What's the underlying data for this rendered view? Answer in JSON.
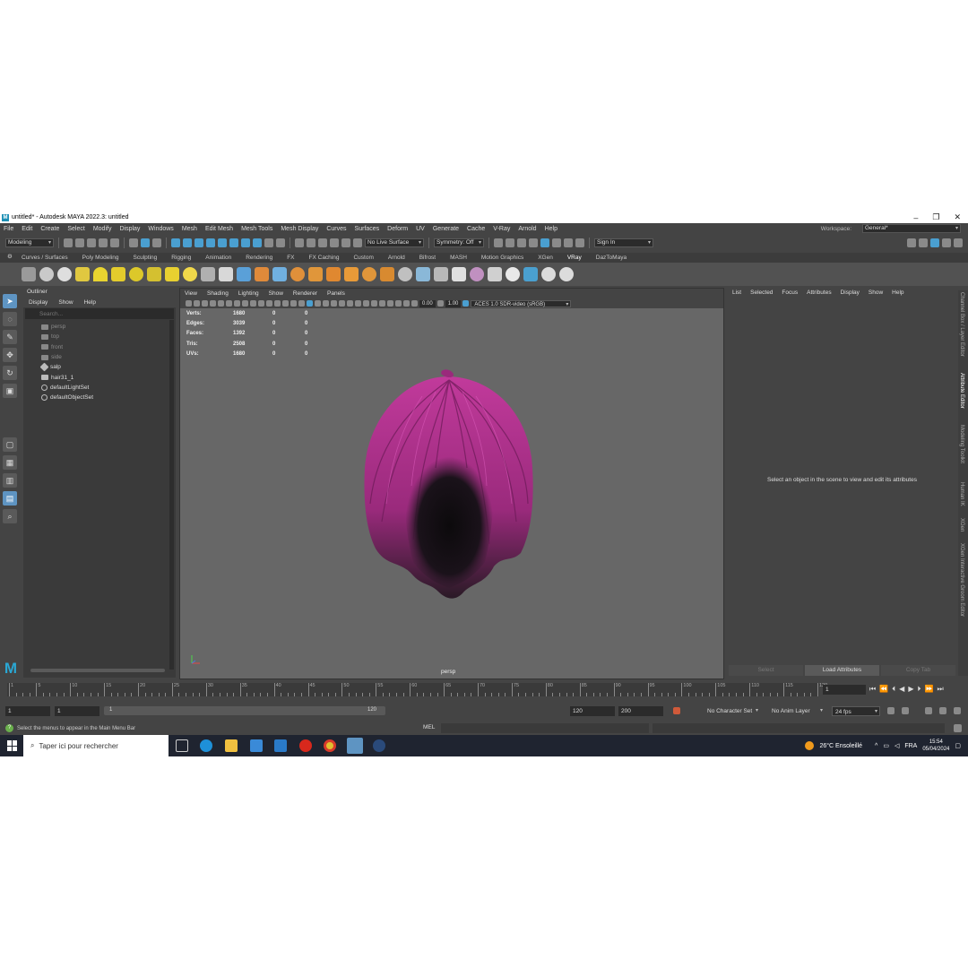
{
  "window": {
    "title": "untitled* - Autodesk MAYA 2022.3: untitled",
    "controls": [
      "–",
      "❐",
      "✕"
    ]
  },
  "menubar": {
    "items": [
      "File",
      "Edit",
      "Create",
      "Select",
      "Modify",
      "Display",
      "Windows",
      "Mesh",
      "Edit Mesh",
      "Mesh Tools",
      "Mesh Display",
      "Curves",
      "Surfaces",
      "Deform",
      "UV",
      "Generate",
      "Cache",
      "V-Ray",
      "Arnold",
      "Help"
    ],
    "workspace_label": "Workspace:",
    "workspace_value": "General*"
  },
  "statusline": {
    "mode": "Modeling",
    "live_surface": "No Live Surface",
    "symmetry": "Symmetry: Off",
    "sign_in": "Sign In"
  },
  "shelf": {
    "tabs": [
      "Curves / Surfaces",
      "Poly Modeling",
      "Sculpting",
      "Rigging",
      "Animation",
      "Rendering",
      "FX",
      "FX Caching",
      "Custom",
      "Arnold",
      "Bifrost",
      "MASH",
      "Motion Graphics",
      "XGen",
      "VRay",
      "DazToMaya"
    ],
    "active_tab": "VRay"
  },
  "outliner": {
    "title": "Outliner",
    "menu": [
      "Display",
      "Show",
      "Help"
    ],
    "search_placeholder": "Search...",
    "items": [
      {
        "label": "persp",
        "dim": true,
        "kind": "camera"
      },
      {
        "label": "top",
        "dim": true,
        "kind": "camera"
      },
      {
        "label": "front",
        "dim": true,
        "kind": "camera"
      },
      {
        "label": "side",
        "dim": true,
        "kind": "camera"
      },
      {
        "label": "salp",
        "dim": false,
        "kind": "transform"
      },
      {
        "label": "hair31_1",
        "dim": false,
        "kind": "camera"
      },
      {
        "label": "defaultLightSet",
        "dim": false,
        "kind": "set"
      },
      {
        "label": "defaultObjectSet",
        "dim": false,
        "kind": "set"
      }
    ]
  },
  "viewport": {
    "menu": [
      "View",
      "Shading",
      "Lighting",
      "Show",
      "Renderer",
      "Panels"
    ],
    "exposure": "0.00",
    "gamma": "1.00",
    "color_space": "ACES 1.0 SDR-video (sRGB)",
    "camera_label": "persp",
    "hud": [
      {
        "label": "Verts:",
        "a": "1680",
        "b": "0",
        "c": "0"
      },
      {
        "label": "Edges:",
        "a": "3039",
        "b": "0",
        "c": "0"
      },
      {
        "label": "Faces:",
        "a": "1392",
        "b": "0",
        "c": "0"
      },
      {
        "label": "Tris:",
        "a": "2508",
        "b": "0",
        "c": "0"
      },
      {
        "label": "UVs:",
        "a": "1680",
        "b": "0",
        "c": "0"
      }
    ],
    "hair_color": "#b2348e"
  },
  "attribute_editor": {
    "menu": [
      "List",
      "Selected",
      "Focus",
      "Attributes",
      "Display",
      "Show",
      "Help"
    ],
    "message": "Select an object in the scene to view and edit its attributes",
    "buttons": [
      "Select",
      "Load Attributes",
      "Copy Tab"
    ]
  },
  "side_tabs": [
    "Channel Box / Layer Editor",
    "Attribute Editor",
    "Modeling Toolkit",
    "Human IK",
    "XGen",
    "XGen Interactive Groom Editor"
  ],
  "timeslider": {
    "tick_labels": [
      "1",
      "5",
      "10",
      "15",
      "20",
      "25",
      "30",
      "35",
      "40",
      "45",
      "50",
      "55",
      "60",
      "65",
      "70",
      "75",
      "80",
      "85",
      "90",
      "95",
      "100",
      "105",
      "110",
      "115",
      "120"
    ],
    "current_frame": "1"
  },
  "rangeslider": {
    "start": "1",
    "playback_start": "1",
    "range_start_label": "1",
    "range_end_label": "120",
    "playback_end": "120",
    "end": "200",
    "character_set": "No Character Set",
    "anim_layer": "No Anim Layer",
    "fps": "24 fps"
  },
  "commandline": {
    "help_text": "Select the menus to appear in the Main Menu Bar",
    "mel_label": "MEL"
  },
  "taskbar": {
    "search_placeholder": "Taper ici pour rechercher",
    "weather": "26°C  Ensoleillé",
    "lang": "FRA",
    "time": "15:54",
    "date": "05/04/2024"
  }
}
